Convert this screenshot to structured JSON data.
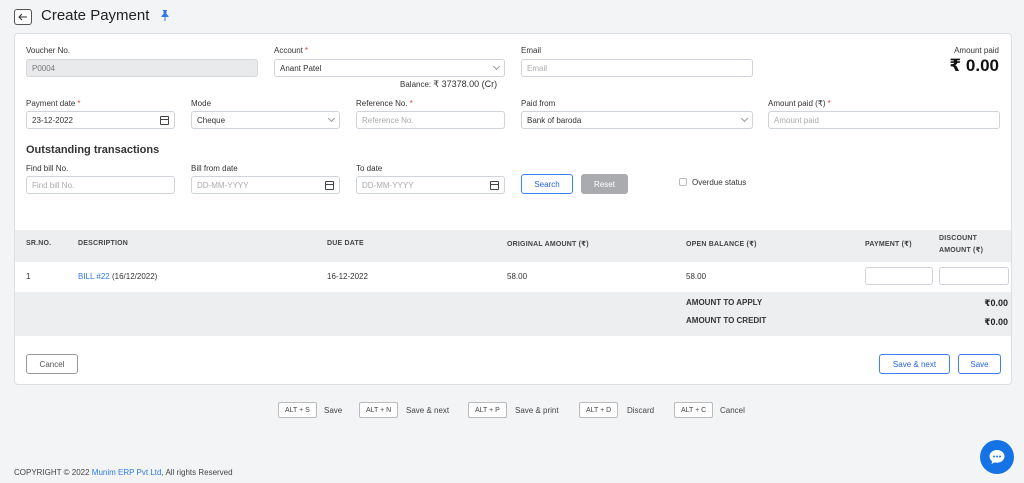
{
  "header": {
    "title": "Create Payment"
  },
  "form": {
    "voucher": {
      "label": "Voucher No.",
      "value": "P0004"
    },
    "account": {
      "label": "Account",
      "value": "Anant Patel",
      "balance_label": "Balance:",
      "balance_value": "₹ 37378.00 (Cr)"
    },
    "email": {
      "label": "Email",
      "placeholder": "Email"
    },
    "amount_paid_summary": {
      "label": "Amount paid",
      "value": "₹ 0.00"
    },
    "payment_date": {
      "label": "Payment date",
      "value": "23-12-2022"
    },
    "mode": {
      "label": "Mode",
      "value": "Cheque"
    },
    "reference": {
      "label": "Reference No.",
      "placeholder": "Reference No."
    },
    "paid_from": {
      "label": "Paid from",
      "value": "Bank of baroda"
    },
    "amount_paid": {
      "label": "Amount paid (₹)",
      "placeholder": "Amount paid"
    }
  },
  "outstanding": {
    "title": "Outstanding transactions",
    "find_bill": {
      "label": "Find bill No.",
      "placeholder": "Find bill No."
    },
    "bill_from": {
      "label": "Bill from date",
      "placeholder": "DD-MM-YYYY"
    },
    "to_date": {
      "label": "To date",
      "placeholder": "DD-MM-YYYY"
    },
    "search_label": "Search",
    "reset_label": "Reset",
    "overdue_label": "Overdue status"
  },
  "table": {
    "headers": {
      "sr": "SR.NO.",
      "description": "DESCRIPTION",
      "due_date": "DUE DATE",
      "original_amount": "ORIGINAL AMOUNT (₹)",
      "open_balance": "OPEN BALANCE (₹)",
      "payment": "PAYMENT (₹)",
      "discount_line1": "DISCOUNT",
      "discount_line2": "AMOUNT (₹)"
    },
    "rows": [
      {
        "sr": "1",
        "bill_link": "BILL #22",
        "bill_date": "(16/12/2022)",
        "due_date": "16-12-2022",
        "original_amount": "58.00",
        "open_balance": "58.00"
      }
    ],
    "totals": {
      "apply_label": "AMOUNT TO APPLY",
      "apply_value": "₹0.00",
      "credit_label": "AMOUNT TO CREDIT",
      "credit_value": "₹0.00"
    }
  },
  "actions": {
    "cancel_label": "Cancel",
    "save_next_label": "Save & next",
    "save_label": "Save"
  },
  "shortcuts": [
    {
      "key": "ALT + S",
      "label": "Save"
    },
    {
      "key": "ALT + N",
      "label": "Save & next"
    },
    {
      "key": "ALT + P",
      "label": "Save & print"
    },
    {
      "key": "ALT + D",
      "label": "Discard"
    },
    {
      "key": "ALT + C",
      "label": "Cancel"
    }
  ],
  "footer": {
    "prefix": "COPYRIGHT © 2022 ",
    "company": "Munim ERP Pvt Ltd",
    "suffix": ", All rights Reserved"
  },
  "colors": {
    "accent": "#2f7ae5",
    "required": "#e23b3b",
    "chat": "#1673e6"
  },
  "icons": [
    "back-arrow-icon",
    "pin-icon",
    "chevron-down-icon",
    "calendar-icon",
    "chat-icon"
  ]
}
